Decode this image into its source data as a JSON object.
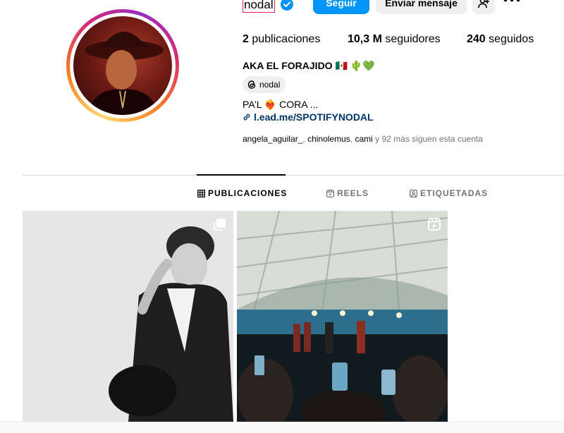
{
  "profile": {
    "username": "nodal",
    "full_name": "AKA EL FORAJIDO 🇲🇽 🌵💚",
    "threads_handle": "nodal",
    "bio": "PA’L ❤️‍🔥 CORA ...",
    "link": "l.ead.me/SPOTIFYNODAL",
    "verified_icon": "verified-badge-icon"
  },
  "actions": {
    "follow_label": "Seguir",
    "message_label": "Enviar mensaje"
  },
  "stats": {
    "posts_count": "2",
    "posts_label": "publicaciones",
    "followers_count": "10,3 M",
    "followers_label": "seguidores",
    "following_count": "240",
    "following_label": "seguidos"
  },
  "followed_by": {
    "user1": "angela_aguilar_",
    "user2": "chinolemus",
    "user3": "cami",
    "rest": "y 92 más siguen esta cuenta"
  },
  "tabs": [
    {
      "label": "PUBLICACIONES",
      "icon": "grid-icon",
      "active": true
    },
    {
      "label": "REELS",
      "icon": "reels-icon",
      "active": false
    },
    {
      "label": "ETIQUETADAS",
      "icon": "tagged-icon",
      "active": false
    }
  ],
  "colors": {
    "accent": "#0095f6",
    "link": "#00376b",
    "secondary_text": "#737373"
  }
}
